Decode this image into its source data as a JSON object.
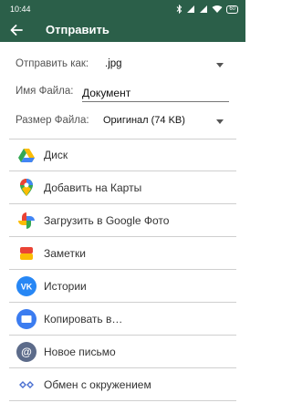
{
  "status_bar": {
    "time": "10:44",
    "battery": "60"
  },
  "app_bar": {
    "title": "Отправить"
  },
  "form": {
    "send_as_label": "Отправить как:",
    "send_as_value": ".jpg",
    "file_name_label": "Имя Файла:",
    "file_name_value": "Документ",
    "file_size_label": "Размер Файла:",
    "file_size_value": "Оригинал (74 KB)"
  },
  "share_targets": [
    {
      "label": "Диск",
      "icon": "google-drive-icon"
    },
    {
      "label": "Добавить на Карты",
      "icon": "google-maps-icon"
    },
    {
      "label": "Загрузить в Google Фото",
      "icon": "google-photos-icon"
    },
    {
      "label": "Заметки",
      "icon": "notes-icon"
    },
    {
      "label": "Истории",
      "icon": "vk-icon"
    },
    {
      "label": "Копировать в…",
      "icon": "folder-icon"
    },
    {
      "label": "Новое письмо",
      "icon": "email-icon"
    },
    {
      "label": "Обмен с окружением",
      "icon": "nearby-share-icon"
    }
  ],
  "colors": {
    "primary": "#2b5f49"
  }
}
